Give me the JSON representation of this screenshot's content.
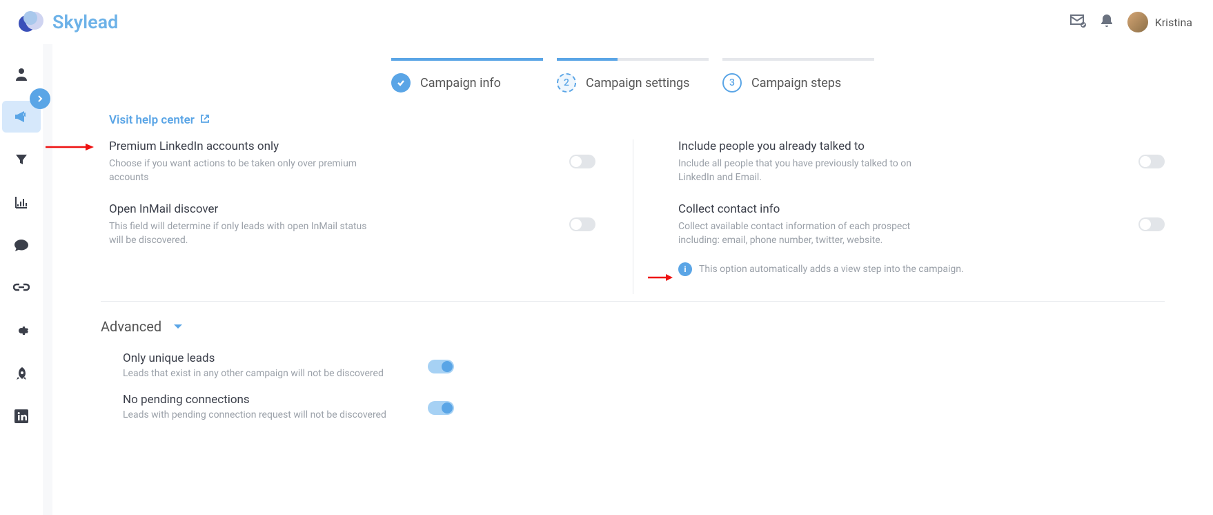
{
  "brand": "Skylead",
  "user": {
    "name": "Kristina"
  },
  "stepper": {
    "steps": [
      {
        "num": "✓",
        "label": "Campaign info"
      },
      {
        "num": "2",
        "label": "Campaign settings"
      },
      {
        "num": "3",
        "label": "Campaign steps"
      }
    ]
  },
  "help_link": "Visit help center",
  "settings": {
    "premium": {
      "title": "Premium LinkedIn accounts only",
      "desc": "Choose if you want actions to be taken only over premium accounts"
    },
    "include_talked": {
      "title": "Include people you already talked to",
      "desc": "Include all people that you have previously talked to on LinkedIn and Email."
    },
    "open_inmail": {
      "title": "Open InMail discover",
      "desc": "This field will determine if only leads with open InMail status will be discovered."
    },
    "collect_contact": {
      "title": "Collect contact info",
      "desc": "Collect available contact information of each prospect including: email, phone number, twitter, website.",
      "note": "This option automatically adds a view step into the campaign."
    }
  },
  "advanced": {
    "header": "Advanced",
    "unique": {
      "title": "Only unique leads",
      "desc": "Leads that exist in any other campaign will not be discovered"
    },
    "pending": {
      "title": "No pending connections",
      "desc": "Leads with pending connection request will not be discovered"
    }
  }
}
